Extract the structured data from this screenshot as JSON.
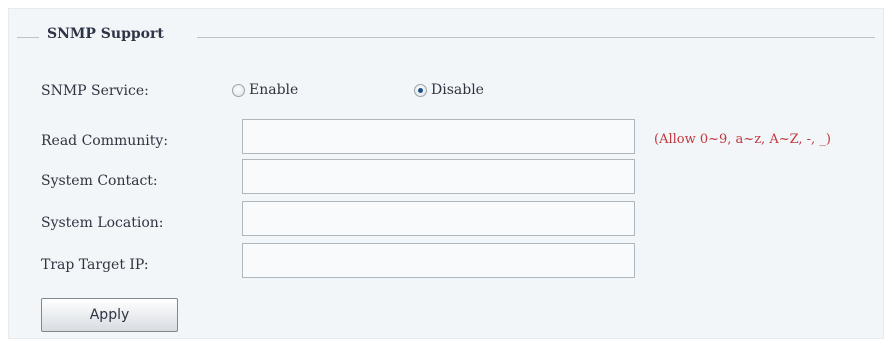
{
  "section": {
    "title": "SNMP Support"
  },
  "snmp_service": {
    "label": "SNMP Service:",
    "options": [
      {
        "label": "Enable",
        "selected": false
      },
      {
        "label": "Disable",
        "selected": true
      }
    ]
  },
  "fields": {
    "read_community": {
      "label": "Read Community:",
      "value": ""
    },
    "system_contact": {
      "label": "System Contact:",
      "value": ""
    },
    "system_location": {
      "label": "System Location:",
      "value": ""
    },
    "trap_target_ip": {
      "label": "Trap Target IP:",
      "value": ""
    }
  },
  "read_community_hint": "(Allow 0~9, a~z, A~Z, -, _)",
  "apply_button": {
    "label": "Apply"
  },
  "colors": {
    "panel_background": "#f3f6f9",
    "hint_text": "#c0383e",
    "radio_selected_dot": "#1e4f86"
  }
}
